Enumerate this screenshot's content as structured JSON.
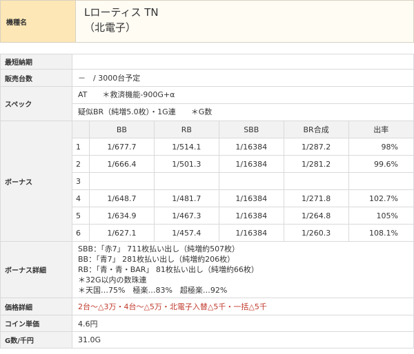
{
  "header": {
    "label": "機種名",
    "title": "Lローティス TN",
    "maker": "（北電子）"
  },
  "rows": {
    "shortest_delivery": {
      "label": "最短納期",
      "value": ""
    },
    "sales_units": {
      "label": "販売台数",
      "value": "－　/ 3000台予定"
    },
    "spec": {
      "label": "スペック",
      "line1": "AT　　＊救済機能-900G+α",
      "line2": "疑似BR（純増5.0枚）・1G連　　＊G数"
    },
    "bonus": {
      "label": "ボーナス",
      "columns": [
        "BB",
        "RB",
        "SBB",
        "BR合成",
        "出率"
      ],
      "settings": [
        {
          "n": "1",
          "bb": "1/677.7",
          "rb": "1/514.1",
          "sbb": "1/16384",
          "br": "1/287.2",
          "rate": "98%"
        },
        {
          "n": "2",
          "bb": "1/666.4",
          "rb": "1/501.3",
          "sbb": "1/16384",
          "br": "1/281.2",
          "rate": "99.6%"
        },
        {
          "n": "3",
          "bb": "",
          "rb": "",
          "sbb": "",
          "br": "",
          "rate": ""
        },
        {
          "n": "4",
          "bb": "1/648.7",
          "rb": "1/481.7",
          "sbb": "1/16384",
          "br": "1/271.8",
          "rate": "102.7%"
        },
        {
          "n": "5",
          "bb": "1/634.9",
          "rb": "1/467.3",
          "sbb": "1/16384",
          "br": "1/264.8",
          "rate": "105%"
        },
        {
          "n": "6",
          "bb": "1/627.1",
          "rb": "1/457.4",
          "sbb": "1/16384",
          "br": "1/260.3",
          "rate": "108.1%"
        }
      ]
    },
    "bonus_detail": {
      "label": "ボーナス詳細",
      "lines": [
        "SBB：「赤7」 711枚払い出し（純増約507枚）",
        "BB：「青7」 281枚払い出し（純増約206枚）",
        "RB：「青・青・BAR」 81枚払い出し（純増約66枚）",
        "＊32G以内の数珠連",
        "＊天国…75%　極楽…83%　超極楽…92%"
      ]
    },
    "price_detail": {
      "label": "価格詳細",
      "value": "2台～△3万・4台～△5万・北電子入替△5千・一括△5千"
    },
    "coin_price": {
      "label": "コイン単価",
      "value": "4.6円"
    },
    "g_per_1000": {
      "label": "G数/千円",
      "value": "31.0G"
    }
  },
  "colors": {
    "header_label_bg": "#fde7b6",
    "header_value_bg": "#fffcf4",
    "label_bg": "#f2f2f2",
    "border": "#d9d9d9",
    "price_text": "#c0392b"
  }
}
